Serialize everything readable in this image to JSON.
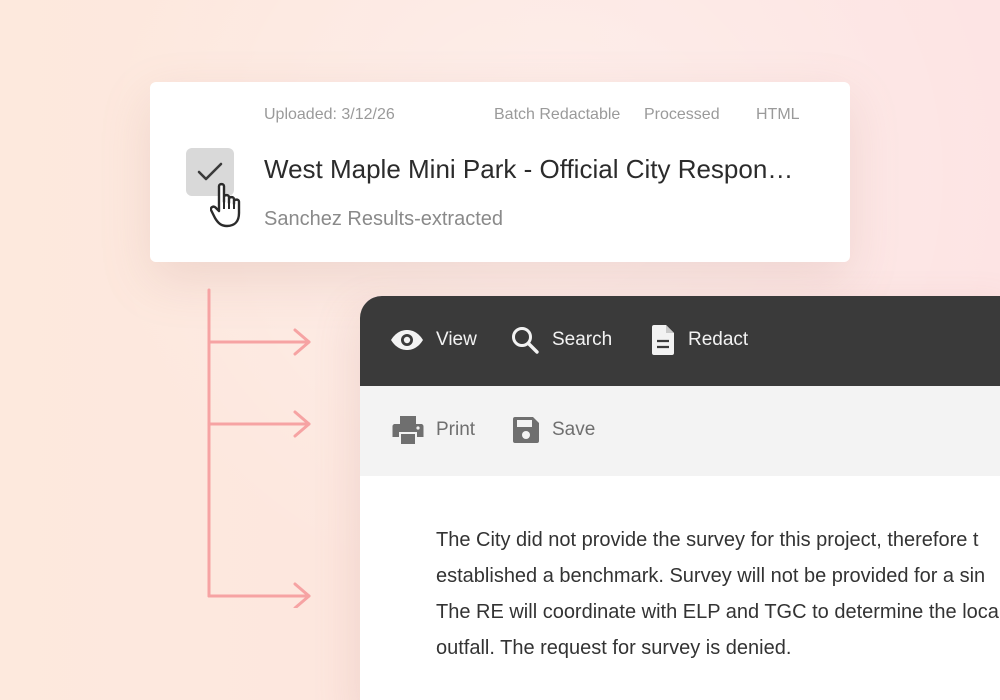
{
  "file": {
    "uploaded": "Uploaded: 3/12/26",
    "batch_status": "Batch Redactable",
    "process_status": "Processed",
    "file_type": "HTML",
    "title": "West Maple Mini Park - Official City Respon…",
    "subtitle": "Sanchez Results-extracted",
    "checked": true,
    "icons": {
      "checkbox": "checkmark-icon",
      "cursor": "hand-pointer-icon"
    }
  },
  "toolbar": {
    "view_label": "View",
    "search_label": "Search",
    "redact_label": "Redact",
    "print_label": "Print",
    "save_label": "Save",
    "icons": {
      "view": "eye-icon",
      "search": "search-icon",
      "redact": "document-icon",
      "print": "printer-icon",
      "save": "floppy-disk-icon"
    }
  },
  "document": {
    "lines": [
      "The City did not provide the survey for this project, therefore t",
      "established a benchmark. Survey will not be provided for a sin",
      "The RE will coordinate with ELP and TGC to determine the loca",
      "outfall. The request for survey is denied."
    ]
  },
  "colors": {
    "accent": "#f6a3a3",
    "toolbar_dark": "#3a3a3a",
    "toolbar_light": "#f3f3f3",
    "checkbox_bg": "#d9d9d9"
  }
}
